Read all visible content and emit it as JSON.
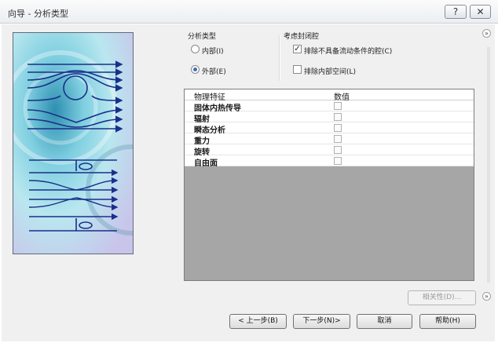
{
  "window": {
    "title": "向导 - 分析类型",
    "help_label": "?",
    "close_label": "✕"
  },
  "analysis_type": {
    "label": "分析类型",
    "options": [
      {
        "label": "内部(I)",
        "selected": false
      },
      {
        "label": "外部(E)",
        "selected": true
      }
    ]
  },
  "closed_cavities": {
    "label": "考虑封闭腔",
    "options": [
      {
        "label": "排除不具备流动条件的腔(C)",
        "checked": true
      },
      {
        "label": "排除内部空间(L)",
        "checked": false
      }
    ]
  },
  "features": {
    "header_name": "物理特征",
    "header_value": "数值",
    "rows": [
      {
        "name": "固体内热传导",
        "checked": false
      },
      {
        "name": "辐射",
        "checked": false
      },
      {
        "name": "瞬态分析",
        "checked": false
      },
      {
        "name": "重力",
        "checked": false
      },
      {
        "name": "旋转",
        "checked": false
      },
      {
        "name": "自由面",
        "checked": false
      }
    ]
  },
  "buttons": {
    "dependency": "相关性(D)...",
    "back": "< 上一步(B)",
    "next": "下一步(N)>",
    "cancel": "取消",
    "help": "帮助(H)"
  },
  "icons": {
    "collapse": "chevrons-right-icon"
  }
}
